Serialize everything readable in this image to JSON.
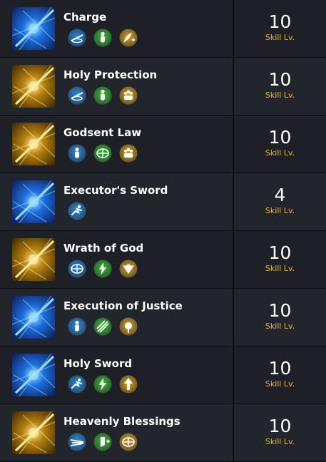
{
  "skills": [
    {
      "name": "Charge",
      "level": "10",
      "level_label": "Skill Lv.",
      "icon": "charge-icon",
      "theme": "blue",
      "badges": [
        "blue-dash-arrow-icon",
        "green-body-icon",
        "gold-boost-icon"
      ]
    },
    {
      "name": "Holy Protection",
      "level": "10",
      "level_label": "Skill Lv.",
      "icon": "holy-protection-icon",
      "theme": "gold",
      "badges": [
        "blue-dash-arrow-icon",
        "green-body-icon",
        "gold-party-icon"
      ]
    },
    {
      "name": "Godsent Law",
      "level": "10",
      "level_label": "Skill Lv.",
      "icon": "godsent-law-icon",
      "theme": "gold",
      "badges": [
        "blue-body-icon",
        "green-target-icon",
        "gold-party-icon"
      ]
    },
    {
      "name": "Executor's Sword",
      "level": "4",
      "level_label": "Skill Lv.",
      "icon": "executors-sword-icon",
      "theme": "blue",
      "badges": [
        "blue-runner-icon"
      ]
    },
    {
      "name": "Wrath of God",
      "level": "10",
      "level_label": "Skill Lv.",
      "icon": "wrath-of-god-icon",
      "theme": "gold",
      "badges": [
        "blue-target-icon",
        "green-lightning-icon",
        "gold-wings-icon"
      ]
    },
    {
      "name": "Execution of Justice",
      "level": "10",
      "level_label": "Skill Lv.",
      "icon": "execution-of-justice-icon",
      "theme": "blue",
      "badges": [
        "blue-body-icon",
        "green-slash-icon",
        "gold-burst-icon"
      ]
    },
    {
      "name": "Holy Sword",
      "level": "10",
      "level_label": "Skill Lv.",
      "icon": "holy-sword-icon",
      "theme": "blue",
      "badges": [
        "blue-runner-icon",
        "green-lightning-icon",
        "gold-arrow-up-icon"
      ]
    },
    {
      "name": "Heavenly Blessings",
      "level": "10",
      "level_label": "Skill Lv.",
      "icon": "heavenly-blessings-icon",
      "theme": "gold",
      "badges": [
        "blue-speed-icon",
        "green-shield-plus-icon",
        "gold-target-icon"
      ]
    }
  ],
  "colors": {
    "level_label": "#e9b82f",
    "badge_blue": "#2f8fe0",
    "badge_green": "#3fbf3a",
    "badge_gold": "#e0a92a"
  }
}
